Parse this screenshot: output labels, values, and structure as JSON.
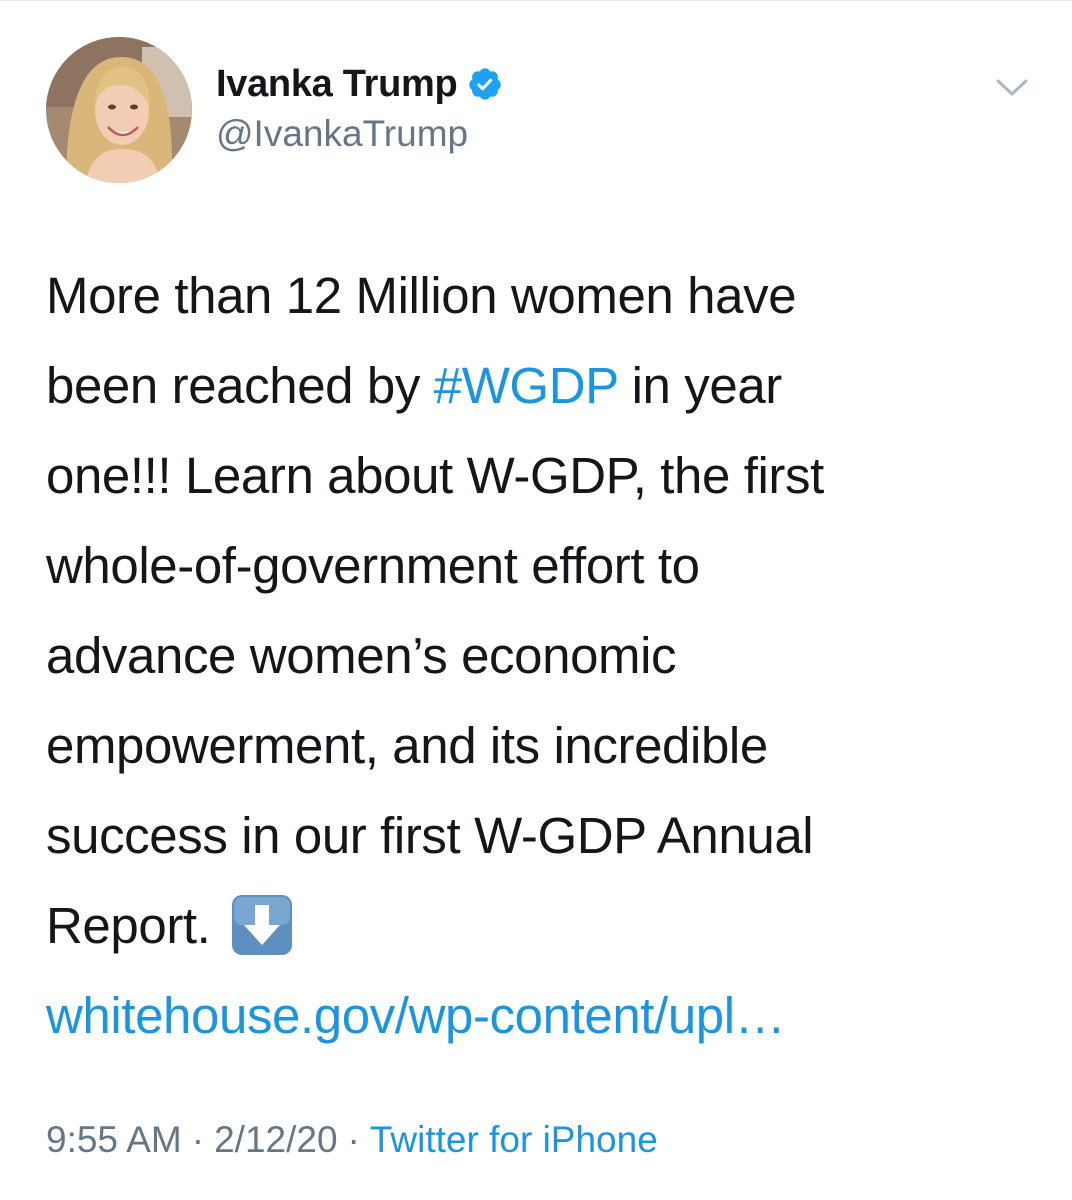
{
  "author": {
    "display_name": "Ivanka Trump",
    "handle": "@IvankaTrump",
    "verified": true
  },
  "icons": {
    "avatar": "profile-photo",
    "verified": "verified-badge-icon",
    "menu": "chevron-down-icon",
    "emoji": "down-arrow-emoji-icon"
  },
  "tweet": {
    "lines": {
      "l1": "More than 12 Million women have",
      "l2_pre": "been reached by ",
      "l2_hashtag": "#WGDP",
      "l2_post": " in year",
      "l3": "one!!! Learn about W-GDP, the first",
      "l4": "whole-of-government effort to",
      "l5": "advance women’s economic",
      "l6": "empowerment, and its incredible",
      "l7": "success in our first W-GDP Annual",
      "l8": "Report."
    },
    "link": "whitehouse.gov/wp-content/upl…"
  },
  "meta": {
    "time": "9:55 AM",
    "separator": "·",
    "date": "2/12/20",
    "source": "Twitter for iPhone"
  },
  "colors": {
    "link": "#1b95e0",
    "text": "#14171a",
    "secondary": "#657786",
    "verified": "#1da1f2"
  }
}
